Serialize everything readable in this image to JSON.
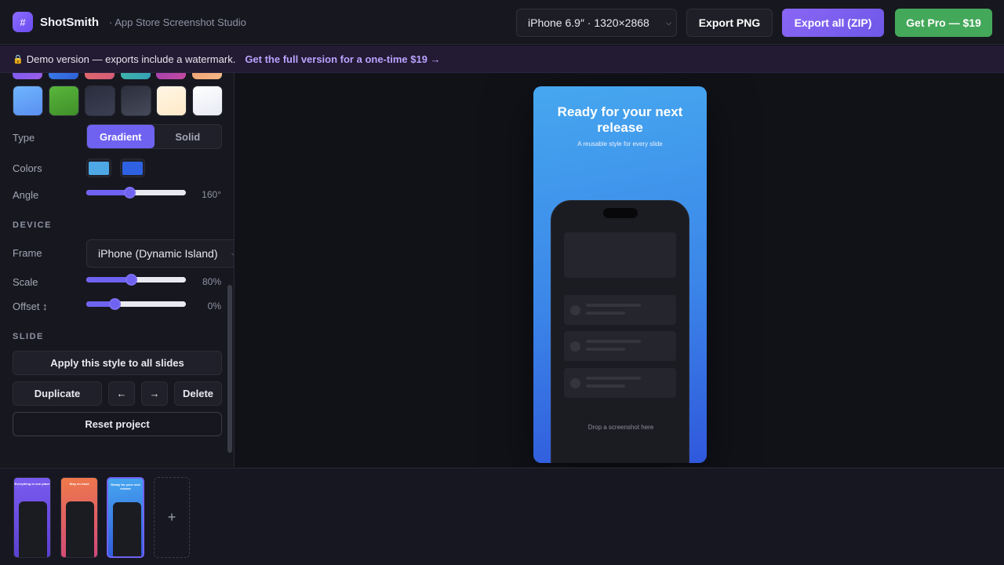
{
  "app": {
    "logo_glyph": "#",
    "name": "ShotSmith",
    "tagline": "· App Store Screenshot Studio"
  },
  "toolbar": {
    "device_select": "iPhone 6.9″ · 1320×2868",
    "export_png": "Export PNG",
    "export_all": "Export all (ZIP)",
    "get_pro": "Get Pro — $19"
  },
  "banner": {
    "message": "Demo version — exports include a watermark.",
    "link": "Get the full version for a one-time $19 →"
  },
  "background": {
    "type_label": "Type",
    "type_options": [
      "Gradient",
      "Solid"
    ],
    "type_selected": "Gradient",
    "colors_label": "Colors",
    "color_1": "#4ea8e6",
    "color_2": "#2f62e2",
    "angle_label": "Angle",
    "angle_value": "160°",
    "angle_fraction": 0.44
  },
  "device": {
    "section_title": "DEVICE",
    "frame_label": "Frame",
    "frame_value": "iPhone (Dynamic Island)",
    "scale_label": "Scale",
    "scale_value": "80%",
    "scale_fraction": 0.46,
    "offset_label": "Offset ↕",
    "offset_value": "0%",
    "offset_fraction": 0.29
  },
  "slide_section": {
    "section_title": "SLIDE",
    "apply_all": "Apply this style to all slides",
    "duplicate": "Duplicate",
    "move_left": "←",
    "move_right": "→",
    "delete": "Delete",
    "reset": "Reset project"
  },
  "preview": {
    "title": "Ready for your next release",
    "subtitle": "A reusable style for every slide",
    "drop_hint": "Drop a screenshot here"
  },
  "thumbnails": [
    {
      "title": "Everything in one place",
      "active": false
    },
    {
      "title": "Stay on track",
      "active": false
    },
    {
      "title": "Ready for your next release",
      "active": true
    }
  ],
  "add_slide": "+"
}
